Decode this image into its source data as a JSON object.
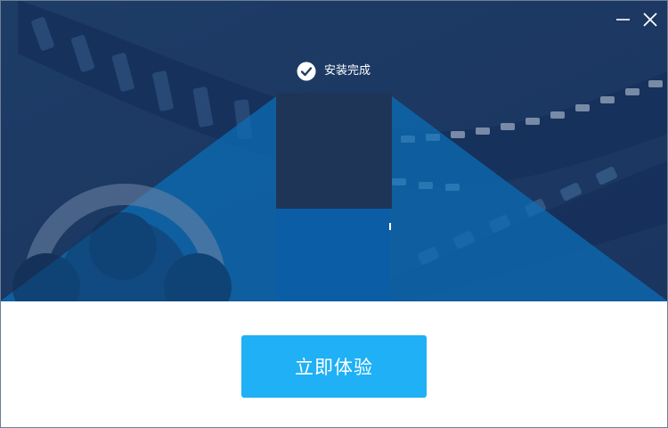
{
  "window": {
    "minimize_icon": "minimize-icon",
    "close_icon": "close-icon"
  },
  "status": {
    "icon": "check-circle-icon",
    "text": "安装完成"
  },
  "cta": {
    "label": "立即体验",
    "color": "#1fb0f5"
  },
  "colors": {
    "hero_bg": "#1b3a63",
    "beam": "#0b6fb8",
    "footer_bg": "#ffffff"
  }
}
